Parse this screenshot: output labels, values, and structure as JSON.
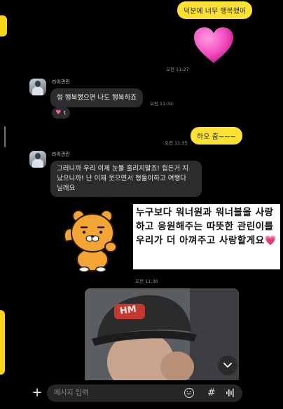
{
  "messages": {
    "me1": "덕분에 너무 행복했어",
    "me1_time": "오전 11:27",
    "other1_name": "라이관린",
    "other1_text": "형 행복했으면 나도 행복하죠",
    "other1_time": "오전 11:34",
    "other1_reaction_count": "1",
    "me2": "하오 춥~~~",
    "me2_time": "오전 11:35",
    "other2_name": "라이관린",
    "other2_line1": "그러니까 우리 이제 눈물 흘리지말죠! 힘든거 지",
    "other2_line2": "났으니까! 난 이제 웃으면서 형들이하고 여행다",
    "other2_line3": "닐래요",
    "photo_time": "오전 11:36"
  },
  "caption": {
    "text": "누구보다 워너원과 워너블을 사랑하고 응원해주는 따뜻한 관린이를 우리가 더 아껴주고 사랑할게요💗"
  },
  "photo": {
    "cap_text": "HM"
  },
  "input": {
    "placeholder": "메시지 입력"
  },
  "colors": {
    "my_bubble": "#fde134",
    "other_bubble": "#2c2c2e",
    "accent": "#f7d51b"
  }
}
